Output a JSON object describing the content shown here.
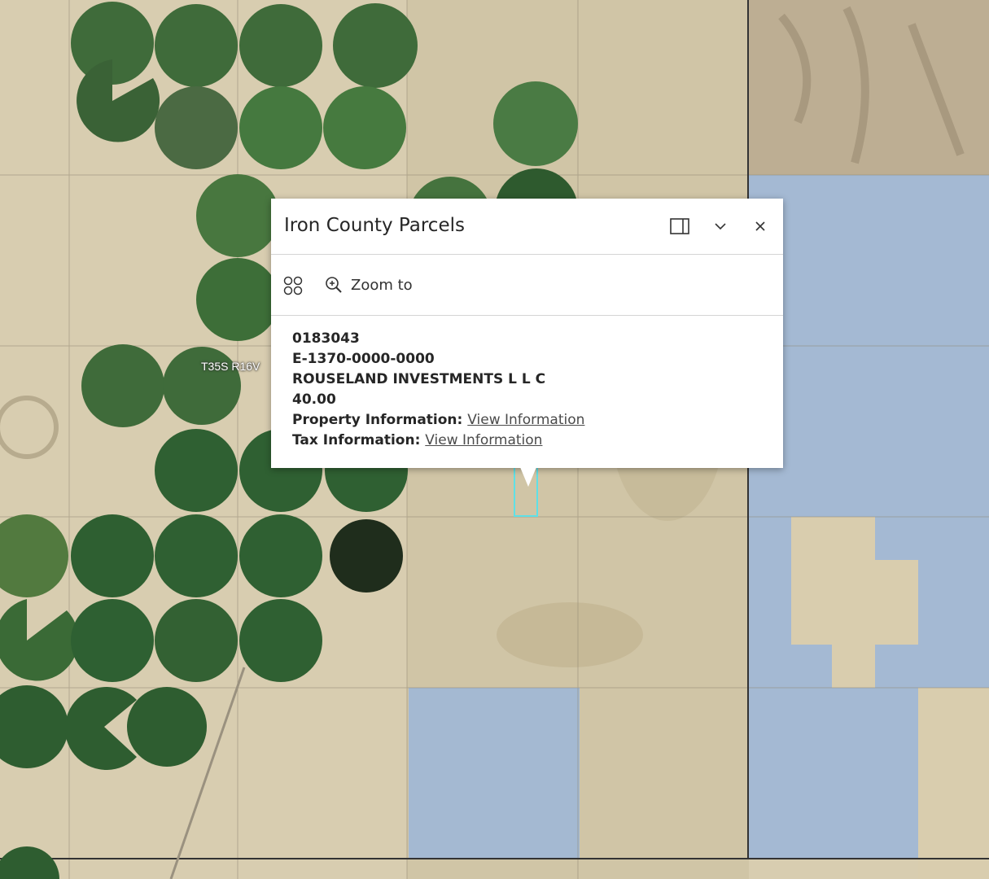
{
  "map": {
    "township_label": "T35S R16V"
  },
  "popup": {
    "title": "Iron County Parcels",
    "actions": {
      "zoom_label": "Zoom to"
    },
    "fields": {
      "parcel_id": "0183043",
      "account_number": "E-1370-0000-0000",
      "owner": "ROUSELAND INVESTMENTS L L C",
      "acreage": "40.00",
      "property_info_label": "Property Information:",
      "property_info_link": "View Information",
      "tax_info_label": "Tax Information:",
      "tax_info_link": "View Information"
    }
  },
  "colors": {
    "desert": "#d8cdb0",
    "crop_green": "#3f6b3a",
    "public_land_blue": "#9fb7d6",
    "selection_cyan": "#5fe0e6"
  }
}
